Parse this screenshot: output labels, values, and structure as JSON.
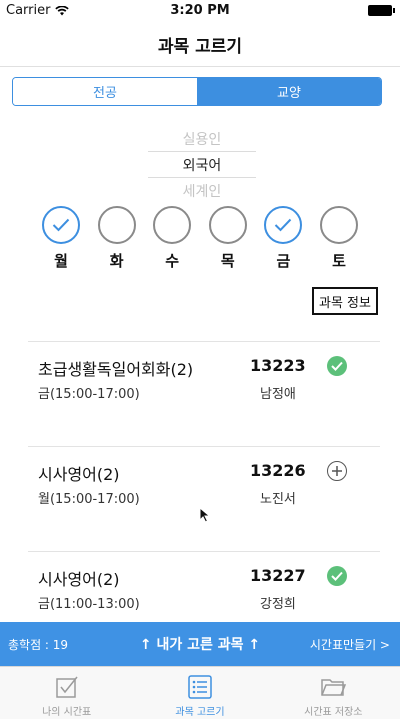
{
  "status_bar": {
    "carrier": "Carrier",
    "time": "3:20 PM"
  },
  "nav": {
    "title": "과목 고르기"
  },
  "segments": [
    {
      "label": "전공",
      "selected": false
    },
    {
      "label": "교양",
      "selected": true
    }
  ],
  "picker": {
    "above": "실용인",
    "selected": "외국어",
    "below": "세계인"
  },
  "days": [
    {
      "label": "월",
      "checked": true
    },
    {
      "label": "화",
      "checked": false
    },
    {
      "label": "수",
      "checked": false
    },
    {
      "label": "목",
      "checked": false
    },
    {
      "label": "금",
      "checked": true
    },
    {
      "label": "토",
      "checked": false
    }
  ],
  "info_button": {
    "label": "과목 정보"
  },
  "courses": [
    {
      "name": "초급생활독일어회화(2)",
      "time": "금(15:00-17:00)",
      "code": "13223",
      "professor": "남정애",
      "status": "added"
    },
    {
      "name": "시사영어(2)",
      "time": "월(15:00-17:00)",
      "code": "13226",
      "professor": "노진서",
      "status": "add"
    },
    {
      "name": "시사영어(2)",
      "time": "금(11:00-13:00)",
      "code": "13227",
      "professor": "강정희",
      "status": "added"
    }
  ],
  "bottom_bar": {
    "credits": "총학점 : 19",
    "picked": "↑ 내가 고른 과목 ↑",
    "make": "시간표만들기 >"
  },
  "tabs": [
    {
      "label": "나의 시간표",
      "icon": "checkbox-icon",
      "active": false
    },
    {
      "label": "과목 고르기",
      "icon": "list-icon",
      "active": true
    },
    {
      "label": "시간표 저장소",
      "icon": "folder-icon",
      "active": false
    }
  ],
  "colors": {
    "accent": "#3d8fe0",
    "bar": "#3f92e4",
    "added": "#5cc07a"
  }
}
